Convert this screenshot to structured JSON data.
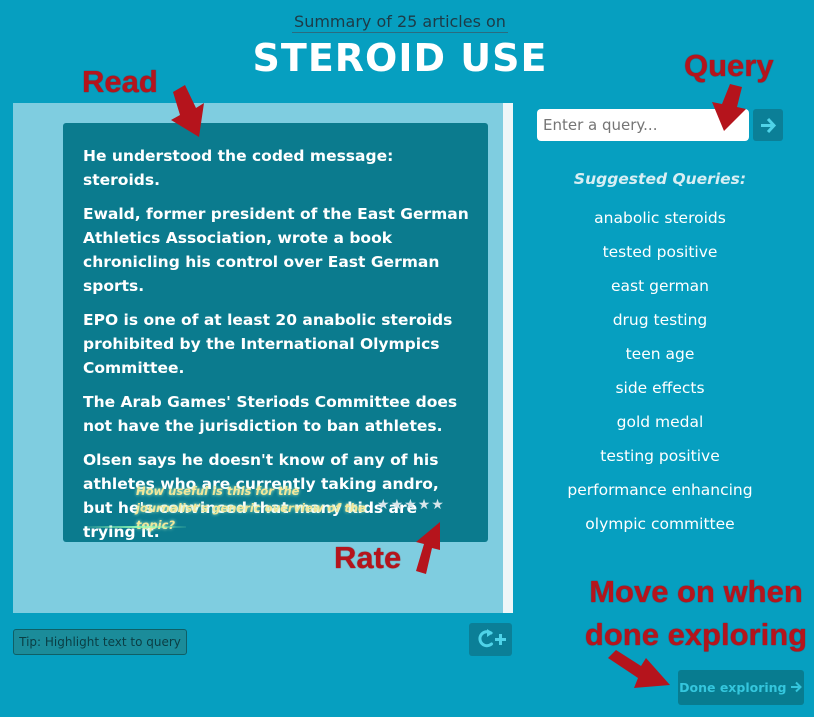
{
  "header": {
    "subtitle": "Summary of 25 articles on",
    "title": "STEROID USE"
  },
  "summary": {
    "sentences": [
      "He understood the coded message: steroids.",
      "Ewald, former president of the East German Athletics Association, wrote a book chronicling his control over East German sports.",
      "EPO is one of at least 20 anabolic steroids prohibited by the International Olympics Committee.",
      "The Arab Games' Steriods Committee does not have the jurisdiction to ban athletes.",
      "Olsen says he doesn't know of any of his athletes who are currently taking andro, but he's convinced that many kids are trying it."
    ],
    "rate_question": "How useful is this for the journalist's generic overview of the topic?",
    "rating": {
      "filled": 0,
      "max": 5
    }
  },
  "tip": "Tip: Highlight text to query",
  "query": {
    "placeholder": "Enter a query...",
    "value": "",
    "suggested_heading": "Suggested Queries:",
    "suggestions": [
      "anabolic steroids",
      "tested positive",
      "east german",
      "drug testing",
      "teen age",
      "side effects",
      "gold medal",
      "testing positive",
      "performance enhancing",
      "olympic committee"
    ]
  },
  "done_label": "Done exploring",
  "annotations": {
    "read": "Read",
    "query": "Query",
    "rate": "Rate",
    "move_line1": "Move on when",
    "move_line2": "done exploring"
  },
  "icons": {
    "query_submit": "arrow-right-icon",
    "refresh": "refresh-plus-icon",
    "done": "arrow-right-icon",
    "star": "star-icon"
  },
  "colors": {
    "background": "#069fc0",
    "panel": "#7fcde0",
    "card": "#0b7b8e",
    "annotation": "#b5141c",
    "question": "#f2e79a"
  }
}
